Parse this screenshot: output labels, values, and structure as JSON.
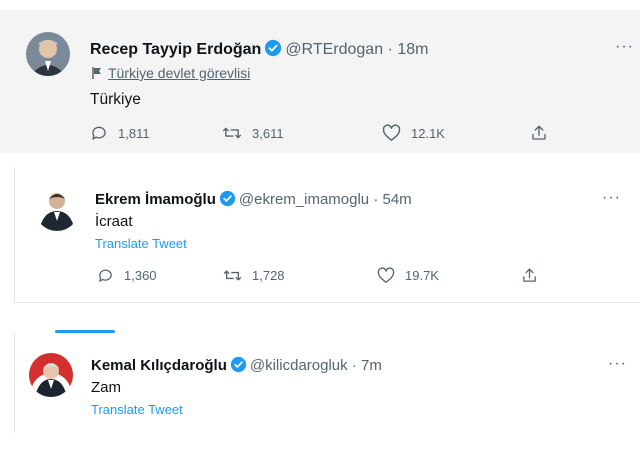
{
  "tweets": [
    {
      "name": "Recep Tayyip Erdoğan",
      "handle": "@RTErdogan",
      "separator": "·",
      "time": "18m",
      "label": "Türkiye devlet görevlisi",
      "text": "Türkiye",
      "replies": "1,811",
      "retweets": "3,611",
      "likes": "12.1K"
    },
    {
      "name": "Ekrem İmamoğlu",
      "handle": "@ekrem_imamoglu",
      "separator": "·",
      "time": "54m",
      "text": "İcraat",
      "translate": "Translate Tweet",
      "replies": "1,360",
      "retweets": "1,728",
      "likes": "19.7K"
    },
    {
      "name": "Kemal Kılıçdaroğlu",
      "handle": "@kilicdarogluk",
      "separator": "·",
      "time": "7m",
      "text": "Zam",
      "translate": "Translate Tweet"
    }
  ],
  "more_label": "···",
  "colors": {
    "accent": "#1d9bf0",
    "muted": "#536471",
    "text": "#0f1419"
  }
}
